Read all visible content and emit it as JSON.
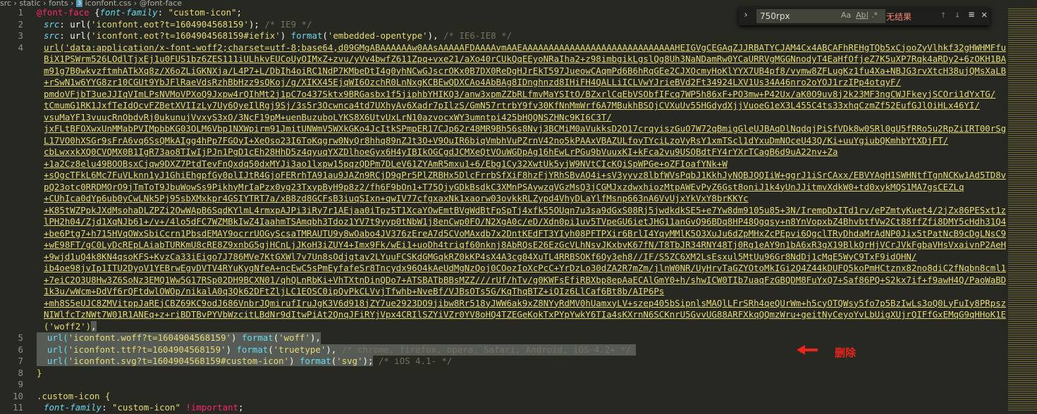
{
  "breadcrumb": [
    "src",
    "static",
    "fonts",
    "iconfont.css",
    "@font-face"
  ],
  "find": {
    "query": "750rpx",
    "status": "无结果",
    "case_label": "Aa",
    "word_label": "Ab|",
    "regex_label": ".*"
  },
  "annotation": "删除",
  "code": {
    "l1": [
      "@font-face",
      " {",
      "font-family",
      ": ",
      "\"custom-icon\"",
      ";"
    ],
    "l2": [
      "src",
      ": url(",
      "'iconfont.eot?t=1604904568159'",
      "); ",
      "/* IE9 */"
    ],
    "l3": [
      "src",
      ": url(",
      "'iconfont.eot?t=1604904568159#iefix'",
      ") ",
      "format",
      "(",
      "'embedded-opentype'",
      "), ",
      "/* IE6-IE8 */"
    ],
    "l4_rows": [
      "url('data:application/x-font-woff2;charset=utf-8;base64,d09GMgABAAAAAAw0AAsAAAAAFDAAAAvmAAEAAAAAAAAAAAAAAAAAAAAAAAAAAAAAHEIGVgCEGAqZJJRBATYCJAM4Cx4ABCAFhREHgTQb5xCjooZyVlhkf32gHWHMFfuCQJaTFdpsRIlb3HHw8T/",
      "BiX1PSWrm526LOdlTjxEj1u0FUS1bz6ZES111iULhkvEUCoUyOIMxZ+zvu/yVv4bwfZ611Zpq+vxe21/aXo40rCUkQqEEyoNRaIha2+z98imbgikLgslQg8Uh3NaNDamRw0YCaURRVgMGGNnodyT4EaHfOfjeZ7K5uXP7Rqk4aRDy2+6zOKH1BAS/",
      "m91g7B0wkvzftmhATkXq8z/X6oZLiGKNXja/L4P7+L/DbIh4oiRC1NdP7KMbeDtI4g0yhNCwGJscrOKx0B7DX0ReDgHJrEkT597JueowCAqmPd6B6hRqGEe2CJXOcmyHoKlYYX7UB4pf8/vymw8ZFLugKz1fu4Xa+NBJG3rvXtcH38ujQMsXaLBNYTZDtbo/1ccD2",
      "+rSwN1w6YYG8zr10CGUt9YbJFlRaeVdsRzhBbHzz9sQKoj/g/XIKX45EjqWI6OzchR0LnNxgKCBEwQDXCAo4AbBAg8IDnghnzd8IHiFH4QALLiICLVwYJrieBVd2Ft34924LXV1Us34A46nro2oYOJ1rzIPp4otqyF/",
      "pmdoVFjbT3ueJJIqVImLPsNVMoVPXoQ9Jxpw4rQIhMt2j1pC7o437Sktx9BRGasbx1f5jiphbYHIKQ3/anw3xpmZZbRLfmvMaYSItO/BZxrlCqEbVSObfIFcq7WP5h86xF+PO3mw+P42Ux/aK0O9uv8j2k23MF3ngCWJFkeyjSCOri1dYxTG/",
      "tCmumG1RK1JxfTeIdQcvFZBetXVIIzLy7Uy6QyeIlRgj9Sj/3s5r3Ocwnca4td7UXhyAv6Xadr7pIlzS/GmN57rtrbY9fv30KfNnMmWrf6A7MBukhBSOjCVXuUv55HGdydXjjVuoeG1eX3L455C4ts33xhqCzmZf52EufGJlOiHLx46YI/",
      "vsuMaYF13vuucRnObdvRj0ukunujVvxyS3xO/3NcF19pM+uenBuzuboLYKS8X6UtvUxLrN10azvocxWY3umntpi425bHQQNSZHNc9KI6C3T/",
      "jxFLtBFOXwxUnMMabPVIMpbbKG03OLM6Vbp1NXWpirm91JmitUNWmV5WXkGKo4JcItkSPmpER17CJp62r48MR9Bh56s8Nvj3BCMiM0aVukksD2O17crqyiszGuO7W72qBmigGleUJBAqDlNqdqjPiSfVDk8w0SRl0gU5fRRo5u2RpZiIRT00rSgSZbV93wP/",
      "L17VO0hXSGr9sFrA6vq6SsQMkAIgg4hPp7FGOyI+XeOso23I6ToKqgrw0NyQr8hhq89nZJt3O+V9OuIR6biqVmbhVuPZrnV42no5kPAAxVBAZULfoyTYciLzoVyRsY1xmTScl1dYxuDmNOceU43Q/Ki+uuYgiubQKmhbYtXDjFT/",
      "cbLwxxkXQ0CVQMX0B1IgR73ao8TIwIjPJn1PgD1cEh28HhD5z4qyuqYXZDlhoeGyx6H4yIBIkOGCgdJCMXeQtVOuWGDpAg16hEwLrPGu9bVuuxKI+kFca2vu9USOBdtFY4rYXrTCagB6d9uA22nv+Za",
      "+1a2Cz8elu49BOOBsxCjqw9DXZ7PtdTevFnQxdq50dxMYJi3ao1lxpw15pqzQDPm7DLeV61ZYAmR5mxu1+6/Ebg1Cy32XwtUk5yjW9NVtCIcKQiSpWPGe+oZFIoafYNk+W",
      "+sQgcTFkL6Mc7FuVLknn1yJ1GhiEhgpfGy0plIJtR4GjoFERrhTA91au9JAZn9RCjD9gPr5PlZRBHx5DlcFrrbSfXiF8hzFjYRhSBvAQ4i+sV3yyvz8lbfWVsPqbJ1KkhJyNQBJQQIiW+ggrJ1iSrCAxx/EBVYAgH1SWHNtfTgnNCKw1Ad5TD8vdcDlPSRyg/",
      "pQ23otc0RRDMOrO9jTmToT9JbuWowSs9PikhyMrIaPzx0yg23TxypByH9p8z2/fh6F9bOn1+T75QjyGDkBsdkC3XMnPSAywzqVGzMsQ3jCGMJxzdwxhiozMtpAWEvPyZ6Gst8oniJ1k4yUnJJitmvXdkW0+td0xykMQS1MA7gsCEZLq",
      "+CUhIca0dYp6ub0yCwLNk5Pj95sbXMxkpr4GSIYTRT7a/xB8zd8GCFsB3iuqSIxn+qwIV77cfgxaxNk1xaorw03ovkkRLZypd4VhyDLaYlfMsnp663nA6VvUjxYkVxY8brKKYc",
      "+K85tWZPpkJXdMsohaDLZPZi2OwWApB6SqdKYlmL4rmxpAJPi3iRy7r1AEjaa0iTpz5T1XcaYOwEmtBVgWdBtFpSpTj4xfk55OUqn7u3sa9dGxS08Rj5jwdkdkSE5+e7Yw8dm9105u85+3N/IrempDxITd1rv/ePZmtyKuet4/2jZx86PESxt1zAvZ+c0tNrkphKxw5HDY/",
      "lPH2h04/Zjd1XqNJb61+/v+/4lo5dFC7WZMBkIwZ4IaahmTSAmqbh3Tdoz1YV7t9yyp0tNbW1j8enCwp0FO/N2XgA0c/eD/Xdn0pi1uv5TVpeGU6ietJHG11anGvQ96BDq8HP48Qgqsy+n8YnVopxbZ4BhvbtfVw2Ct88ffZfi8DMY5cHdh31Q4uqfDohuBLaP66HcN",
      "+be6Ptg7+h715HVqOWxSbiCcrn1PbsdEMAY9ocrrUOGyScsaTMRAUTU9y8wOabo4JV376zEreA7d5CVoMAxdb7x2DntKEdFT3YIyh08PFTPXir6BrlI4YqyMMlK5O3XuJu6dZpMHxZcPEpvi6QgclTRyDhdaMrAdNP0Jix5tPatNcB9cDgLNsC969b1EbQAL3Dfziy/1X6",
      "+wE98FT/gC0LyDcREpLAiabTURKmU8cRE8Z9xnbG5gjHCnLjJKoH3iZUY4+Imx9Fk/wEi1+uoDh4triqf60nknj8AbRQsE26EzGcVLhNsvJKxbvK67fN/T8TbJR34RNY48Tj0Rg1eAY9n1bA6xR3gX19BlkQrHjVCrJVkFgbaVHsVxaivnP2AeHpPKf",
      "+9wjd1uQ4k8KN4qsoKFS+KvzCa33iEigo7J786MVe7KtGXWl7v7Un8sOdjgtav2LYuuFCSKdGMGqkRZ0kKP4sX4A3cg04XuTL4RRBSOKf6Qy3eh8//IF/S5ZC6XM2LsEsxul5MtUu96Gr8NdDj1cMqE5WyC9TxF9idOHN/",
      "ib4oe98jvIp1ITU2DyoV1YEBrwEgvDVTV4RYuKygNfeA+ncEwC5sPmEyfafeSr8Tncydx96O4kAeUdMgNzQoj0COozIoXcPcC+YrDzLo30dZA2R7mZm/jlnW0NR/UyHrvTaGZYOtoMkIGi2Q4Z44kDUFQ5koPmHCtznx82no8diC2fNqbn8cml1xmnd6VsUQdHt",
      "+7eiC2O3U8Hw3Z6SoNz3EMQ1Ww5G17RSp02DH9BCXN01/qhQLnRbKi+VhTXtnDinQDo7+ATSBATbBBsMZZ///rUf/hTv/g0KWFsEfiRBXbp8epAaECAlGmY0+h/shwICW0TIb7uaqFzGBQDM8FuYxQ7+Saf86PQ+S2kx7if+f9awH4Q/PaoWaBD8opF8O7rM+1FRta1/",
      "1k3u/wWcm+DdVf6rQFtdwlOWOp/nikalA0q3Qk62DFtZljLC1EOSC0ipQvPkCLVvjTfwhb+NveBf/VJBsOTs5G/KqThqBTZ+iQIz6LlCaf6Bt8b/AIP6Ps",
      "+mh8S5eUJC8ZMVitppJaREjCBZ69KC9odJ686VnbrJQmirufIruJgK3V6d918jZY7ue2923DO9jibw8Rr518yJWW6ak9xZ8NYyRdMV0hUamxyLV+szep405bSipnlsMAQlLFrSRh4qeQUrWm+h5cyOTQWsy5fo7p5BzIwLs3oQ0LyFuIy8PRpszbZbH7wuQuOtu49jslJM/",
      "NIWlfcTzNWt7W01R1ANEq+z+riBDTBvPYVbWzcitLBdNr9dItwPiAt2QnqJFiRYjVpx4CRIlSZYiVZr0YV8oHQ4TZEGeKokTxPYpYwkY6TIa4sKXrnN6SCKnrU5GvvUG88ARFXkqQQmzWru+geitNyCeyoYvLbUigXUjrQIFfGxEMqG9qHHoK1EKAA==') format"
    ],
    "l4_end": [
      "('woff2')",
      ","
    ],
    "l5": [
      "url(",
      "'iconfont.woff?t=1604904568159'",
      ") ",
      "format",
      "(",
      "'woff'",
      "),"
    ],
    "l6": [
      "url(",
      "'iconfont.ttf?t=1604904568159'",
      ") ",
      "format",
      "(",
      "'truetype'",
      "), ",
      "/* chrome, firefox, opera, Safari, Android, iOS 4.2+ */"
    ],
    "l7": [
      "url(",
      "'iconfont.svg?t=1604904568159#custom-icon'",
      ") ",
      "format",
      "(",
      "'svg'",
      ");",
      " /* iOS 4.1- */"
    ],
    "l8": "}",
    "l10": [
      ".custom-icon",
      " {"
    ],
    "l11": [
      "font-family",
      ": ",
      "\"custom-icon\"",
      " !important",
      ";"
    ],
    "line_numbers": [
      "1",
      "2",
      "3",
      "4",
      "5",
      "6",
      "7",
      "8",
      "9",
      "10",
      "11"
    ]
  },
  "colors": {
    "background": "#272822",
    "string": "#e6db74",
    "keyword": "#f92672",
    "function": "#66d9ef",
    "comment": "#75715e",
    "annotation": "#e8261e"
  }
}
